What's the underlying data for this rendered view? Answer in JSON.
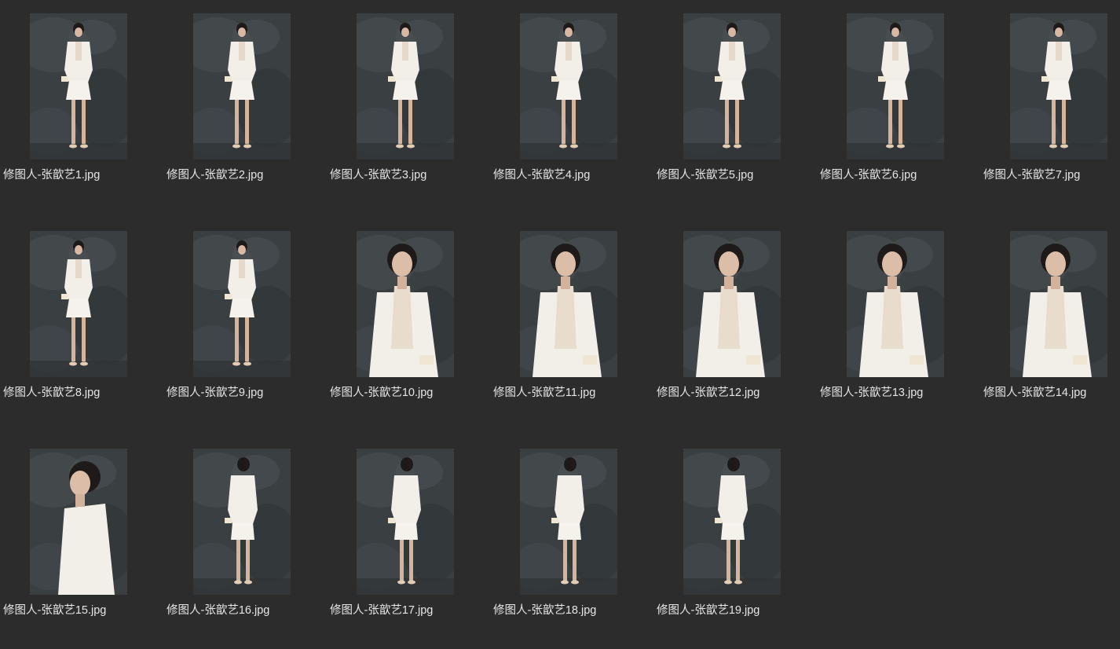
{
  "files": [
    {
      "name": "修图人-张歆艺1.jpg",
      "shot": "full"
    },
    {
      "name": "修图人-张歆艺2.jpg",
      "shot": "full"
    },
    {
      "name": "修图人-张歆艺3.jpg",
      "shot": "full"
    },
    {
      "name": "修图人-张歆艺4.jpg",
      "shot": "full"
    },
    {
      "name": "修图人-张歆艺5.jpg",
      "shot": "full"
    },
    {
      "name": "修图人-张歆艺6.jpg",
      "shot": "full"
    },
    {
      "name": "修图人-张歆艺7.jpg",
      "shot": "full"
    },
    {
      "name": "修图人-张歆艺8.jpg",
      "shot": "full"
    },
    {
      "name": "修图人-张歆艺9.jpg",
      "shot": "full"
    },
    {
      "name": "修图人-张歆艺10.jpg",
      "shot": "half"
    },
    {
      "name": "修图人-张歆艺11.jpg",
      "shot": "half"
    },
    {
      "name": "修图人-张歆艺12.jpg",
      "shot": "half"
    },
    {
      "name": "修图人-张歆艺13.jpg",
      "shot": "half"
    },
    {
      "name": "修图人-张歆艺14.jpg",
      "shot": "half"
    },
    {
      "name": "修图人-张歆艺15.jpg",
      "shot": "side"
    },
    {
      "name": "修图人-张歆艺16.jpg",
      "shot": "back"
    },
    {
      "name": "修图人-张歆艺17.jpg",
      "shot": "back"
    },
    {
      "name": "修图人-张歆艺18.jpg",
      "shot": "back"
    },
    {
      "name": "修图人-张歆艺19.jpg",
      "shot": "back"
    }
  ],
  "colors": {
    "background": "#2c2c2c",
    "label_text": "#e6e6e6",
    "photo_backdrop": "#3b4043",
    "outfit": "#f2efe8"
  }
}
